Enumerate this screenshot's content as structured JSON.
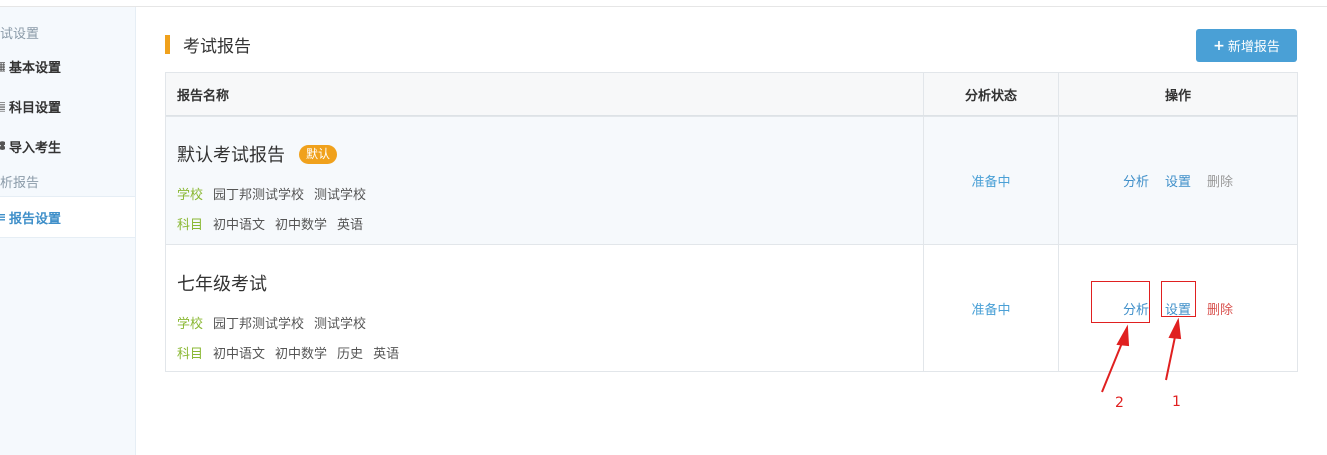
{
  "sidebar": {
    "group1_title": "试设置",
    "items": [
      {
        "icon": "grid-icon",
        "glyph": "▦",
        "label": "基本设置"
      },
      {
        "icon": "book-icon",
        "glyph": "▤",
        "label": "科目设置"
      },
      {
        "icon": "users-icon",
        "glyph": "⚉",
        "label": "导入考生"
      }
    ],
    "group2_title": "析报告",
    "active_item": {
      "icon": "sliders-icon",
      "glyph": "≡",
      "label": "报告设置"
    }
  },
  "page": {
    "title": "考试报告",
    "add_button": "新增报告",
    "add_icon_glyph": "+"
  },
  "table": {
    "headers": {
      "name": "报告名称",
      "status": "分析状态",
      "actions": "操作"
    },
    "rows": [
      {
        "name": "默认考试报告",
        "badge": "默认",
        "school_label": "学校",
        "schools": [
          "园丁邦测试学校",
          "测试学校"
        ],
        "subject_label": "科目",
        "subjects": [
          "初中语文",
          "初中数学",
          "英语"
        ],
        "status": "准备中",
        "actions": {
          "analyze": "分析",
          "settings": "设置",
          "delete": "删除"
        }
      },
      {
        "name": "七年级考试",
        "school_label": "学校",
        "schools": [
          "园丁邦测试学校",
          "测试学校"
        ],
        "subject_label": "科目",
        "subjects": [
          "初中语文",
          "初中数学",
          "历史",
          "英语"
        ],
        "status": "准备中",
        "actions": {
          "analyze": "分析",
          "settings": "设置",
          "delete": "删除"
        }
      }
    ]
  },
  "annotations": {
    "label_1": "1",
    "label_2": "2"
  },
  "colors": {
    "accent": "#4aa0d6",
    "title_bar": "#f0a11c",
    "badge": "#f0a11c",
    "label_green": "#8ab833",
    "delete_red": "#d9534f",
    "annotation": "#e02020"
  }
}
